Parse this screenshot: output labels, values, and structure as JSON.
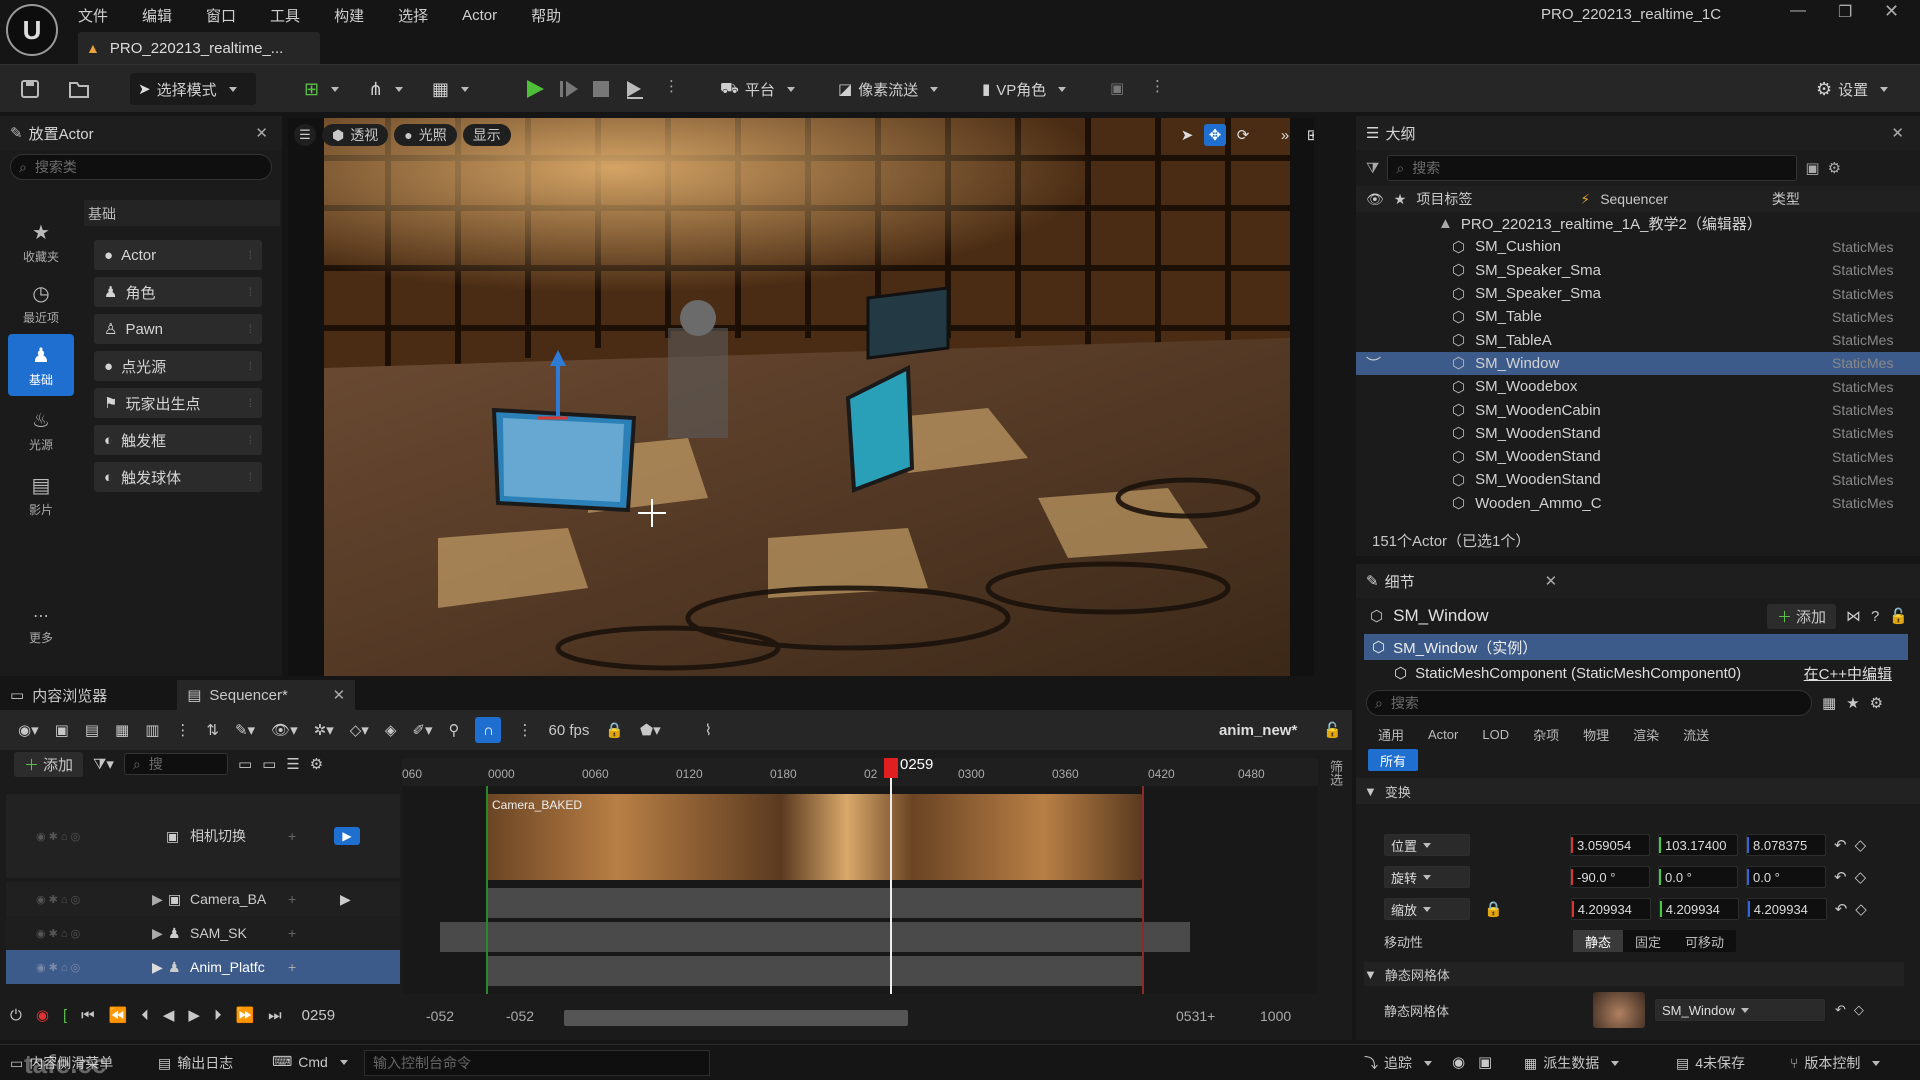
{
  "menu": {
    "items": [
      "文件",
      "编辑",
      "窗口",
      "工具",
      "构建",
      "选择",
      "Actor",
      "帮助"
    ],
    "project_title": "PRO_220213_realtime_1C",
    "doc_tab": "PRO_220213_realtime_..."
  },
  "toolbar": {
    "select_mode": "选择模式",
    "platforms": "平台",
    "pixel_streaming": "像素流送",
    "vp_role": "VP角色",
    "settings": "设置"
  },
  "place_actors": {
    "title": "放置Actor",
    "search_placeholder": "搜索类",
    "category_title": "基础",
    "categories": [
      {
        "label": "收藏夹",
        "icon": "star-icon"
      },
      {
        "label": "最近项",
        "icon": "clock-icon"
      },
      {
        "label": "基础",
        "icon": "shapes-icon"
      },
      {
        "label": "光源",
        "icon": "bulb-icon"
      },
      {
        "label": "影片",
        "icon": "clapper-icon"
      },
      {
        "label": "更多",
        "icon": "more-icon"
      }
    ],
    "items": [
      "Actor",
      "角色",
      "Pawn",
      "点光源",
      "玩家出生点",
      "触发框",
      "触发球体"
    ]
  },
  "viewport": {
    "perspective": "透视",
    "lit": "光照",
    "show": "显示"
  },
  "outliner": {
    "title": "大纲",
    "search_placeholder": "搜索",
    "col_label": "项目标签",
    "col_sequencer": "Sequencer",
    "col_type": "类型",
    "root": "PRO_220213_realtime_1A_教学2（编辑器）",
    "rows": [
      {
        "name": "SM_Cushion",
        "type": "StaticMes"
      },
      {
        "name": "SM_Speaker_Sma",
        "type": "StaticMes"
      },
      {
        "name": "SM_Speaker_Sma",
        "type": "StaticMes"
      },
      {
        "name": "SM_Table",
        "type": "StaticMes"
      },
      {
        "name": "SM_TableA",
        "type": "StaticMes"
      },
      {
        "name": "SM_Window",
        "type": "StaticMes",
        "selected": true
      },
      {
        "name": "SM_Woodebox",
        "type": "StaticMes"
      },
      {
        "name": "SM_WoodenCabin",
        "type": "StaticMes"
      },
      {
        "name": "SM_WoodenStand",
        "type": "StaticMes"
      },
      {
        "name": "SM_WoodenStand",
        "type": "StaticMes"
      },
      {
        "name": "SM_WoodenStand",
        "type": "StaticMes"
      },
      {
        "name": "Wooden_Ammo_C",
        "type": "StaticMes"
      }
    ],
    "footer": "151个Actor（已选1个）"
  },
  "details": {
    "title": "细节",
    "object": "SM_Window",
    "add": "添加",
    "instance": "SM_Window（实例）",
    "component": "StaticMeshComponent (StaticMeshComponent0)",
    "edit_cpp": "在C++中编辑",
    "search_placeholder": "搜索",
    "tabs": [
      "通用",
      "Actor",
      "LOD",
      "杂项",
      "物理",
      "渲染",
      "流送"
    ],
    "tab_all": "所有",
    "transform": "变换",
    "location": "位置",
    "rotation": "旋转",
    "scale": "缩放",
    "loc": [
      "3.059054",
      "103.17400",
      "8.078375"
    ],
    "rot": [
      "-90.0 °",
      "0.0 °",
      "0.0 °"
    ],
    "scl": [
      "4.209934",
      "4.209934",
      "4.209934"
    ],
    "mobility": "移动性",
    "mob_options": [
      "静态",
      "固定",
      "可移动"
    ],
    "static_mesh_section": "静态网格体",
    "static_mesh_label": "静态网格体",
    "mesh_value": "SM_Window"
  },
  "sequencer": {
    "tab_content": "内容浏览器",
    "tab_seq": "Sequencer*",
    "fps": "60 fps",
    "seq_name": "anim_new*",
    "add": "添加",
    "search_placeholder": "搜",
    "tracks": [
      {
        "name": "相机切换"
      },
      {
        "name": "Camera_BA"
      },
      {
        "name": "SAM_SK"
      },
      {
        "name": "Anim_Platfc"
      }
    ],
    "ticks": [
      "060",
      "0000",
      "0060",
      "0120",
      "0180",
      "02",
      "0300",
      "0360",
      "0420",
      "0480"
    ],
    "playhead": "0259",
    "clip_label": "Camera_BAKED",
    "current_frame": "0259",
    "start_a": "-052",
    "start_b": "-052",
    "end_a": "0531+",
    "end_b": "1000",
    "filter": "筛选"
  },
  "statusbar": {
    "drawer": "内容侧滑菜单",
    "output_log": "输出日志",
    "cmd": "Cmd",
    "console_placeholder": "输入控制台命令",
    "trace": "追踪",
    "derived_data": "派生数据",
    "unsaved": "4未保存",
    "source_control": "版本控制",
    "watermark": "tafe.cc"
  }
}
